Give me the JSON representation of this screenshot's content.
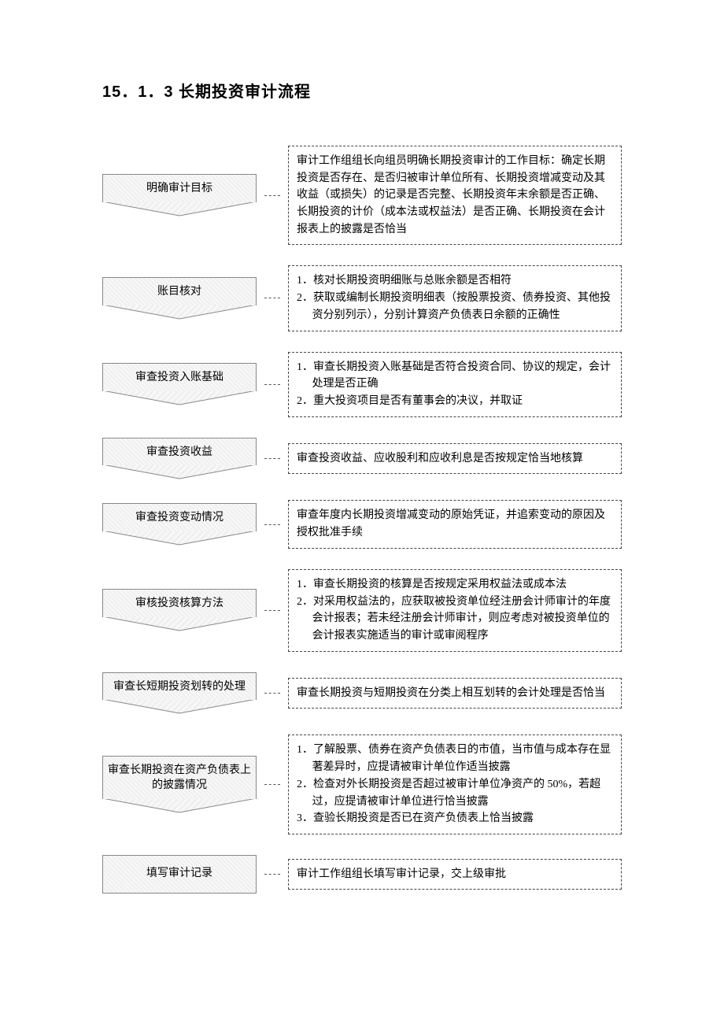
{
  "title": "15．1．3  长期投资审计流程",
  "steps": [
    {
      "label": "明确审计目标",
      "desc_lines": [
        "审计工作组组长向组员明确长期投资审计的工作目标：确定长期投资是否存在、是否归被审计单位所有、长期投资增减变动及其收益（或损失）的记录是否完整、长期投资年末余额是否正确、长期投资的计价（成本法或权益法）是否正确、长期投资在会计报表上的披露是否恰当"
      ],
      "indent": [
        false
      ]
    },
    {
      "label": "账目核对",
      "desc_lines": [
        "1．核对长期投资明细账与总账余额是否相符",
        "2．获取或编制长期投资明细表（按股票投资、债券投资、其他投资分别列示），分别计算资产负债表日余额的正确性"
      ],
      "indent": [
        true,
        true
      ]
    },
    {
      "label": "审查投资入账基础",
      "desc_lines": [
        "1．审查长期投资入账基础是否符合投资合同、协议的规定，会计处理是否正确",
        "2．重大投资项目是否有董事会的决议，并取证"
      ],
      "indent": [
        true,
        true
      ]
    },
    {
      "label": "审查投资收益",
      "desc_lines": [
        "审查投资收益、应收股利和应收利息是否按规定恰当地核算"
      ],
      "indent": [
        false
      ]
    },
    {
      "label": "审查投资变动情况",
      "desc_lines": [
        "审查年度内长期投资增减变动的原始凭证，并追索变动的原因及授权批准手续"
      ],
      "indent": [
        false
      ]
    },
    {
      "label": "审核投资核算方法",
      "desc_lines": [
        "1．审查长期投资的核算是否按规定采用权益法或成本法",
        "2．对采用权益法的，应获取被投资单位经注册会计师审计的年度会计报表；若未经注册会计师审计，则应考虑对被投资单位的会计报表实施适当的审计或审阅程序"
      ],
      "indent": [
        true,
        true
      ]
    },
    {
      "label": "审查长短期投资划转的处理",
      "desc_lines": [
        "审查长期投资与短期投资在分类上相互划转的会计处理是否恰当"
      ],
      "indent": [
        false
      ]
    },
    {
      "label": "审查长期投资在资产负债表上的披露情况",
      "desc_lines": [
        "1．了解股票、债券在资产负债表日的市值，当市值与成本存在显著差异时，应提请被审计单位作适当披露",
        "2．检查对外长期投资是否超过被审计单位净资产的 50%，若超过，应提请被审计单位进行恰当披露",
        "3．查验长期投资是否已在资产负债表上恰当披露"
      ],
      "indent": [
        true,
        true,
        true
      ]
    },
    {
      "label": "填写审计记录",
      "desc_lines": [
        "审计工作组组长填写审计记录，交上级审批"
      ],
      "indent": [
        false
      ],
      "last": true
    }
  ]
}
